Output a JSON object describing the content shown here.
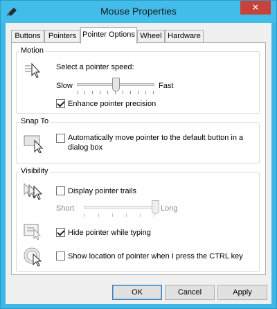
{
  "window": {
    "title": "Mouse Properties",
    "close_glyph": "✕"
  },
  "tabs": [
    {
      "label": "Buttons"
    },
    {
      "label": "Pointers"
    },
    {
      "label": "Pointer Options"
    },
    {
      "label": "Wheel"
    },
    {
      "label": "Hardware"
    }
  ],
  "motion": {
    "group_label": "Motion",
    "speed_prompt": "Select a pointer speed:",
    "slow_label": "Slow",
    "fast_label": "Fast",
    "speed_value": 0.5,
    "enhance_label": "Enhance pointer precision",
    "enhance_checked": true
  },
  "snap_to": {
    "group_label": "Snap To",
    "auto_move_label_line1": "Automatically move pointer to the default button in a",
    "auto_move_label_line2": "dialog box",
    "auto_move_checked": false
  },
  "visibility": {
    "group_label": "Visibility",
    "trails_label": "Display pointer trails",
    "trails_checked": false,
    "short_label": "Short",
    "long_label": "Long",
    "trails_value": 1.0,
    "hide_label": "Hide pointer while typing",
    "hide_checked": true,
    "ctrl_label": "Show location of pointer when I press the CTRL key",
    "ctrl_checked": false
  },
  "buttons": {
    "ok": "OK",
    "cancel": "Cancel",
    "apply": "Apply"
  },
  "colors": {
    "title_bar": "#42bdea",
    "close": "#c7423a",
    "accent": "#3c7fb1"
  },
  "icons": [
    "mouse-app-icon",
    "pointer-speed-icon",
    "snap-to-icon",
    "pointer-trails-icon",
    "hide-pointer-icon",
    "pointer-location-icon"
  ]
}
